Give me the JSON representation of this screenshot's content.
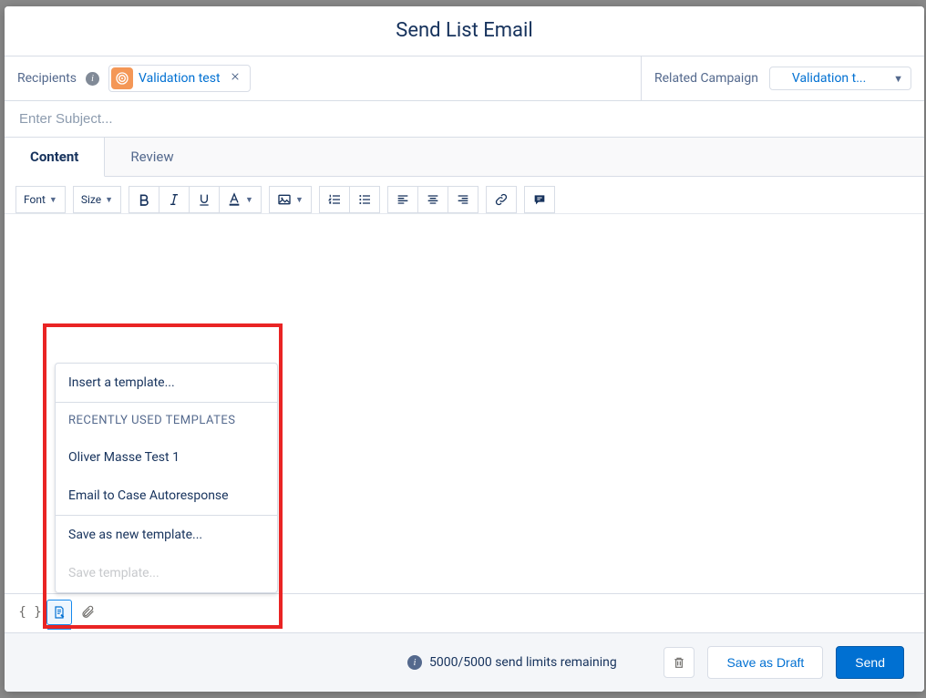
{
  "header": {
    "title": "Send List Email"
  },
  "recipients": {
    "label": "Recipients",
    "chip": {
      "text": "Validation test"
    }
  },
  "related_campaign": {
    "label": "Related Campaign",
    "chip": {
      "text": "Validation t..."
    }
  },
  "subject": {
    "placeholder": "Enter Subject..."
  },
  "tabs": {
    "content": "Content",
    "review": "Review"
  },
  "toolbar": {
    "font": "Font",
    "size": "Size"
  },
  "template_popup": {
    "insert": "Insert a template...",
    "recent_header": "RECENTLY USED TEMPLATES",
    "recent": [
      "Oliver Masse Test 1",
      "Email to Case Autoresponse"
    ],
    "save_new": "Save as new template...",
    "save": "Save template..."
  },
  "footer": {
    "limits": "5000/5000 send limits remaining",
    "save_draft": "Save as Draft",
    "send": "Send"
  }
}
